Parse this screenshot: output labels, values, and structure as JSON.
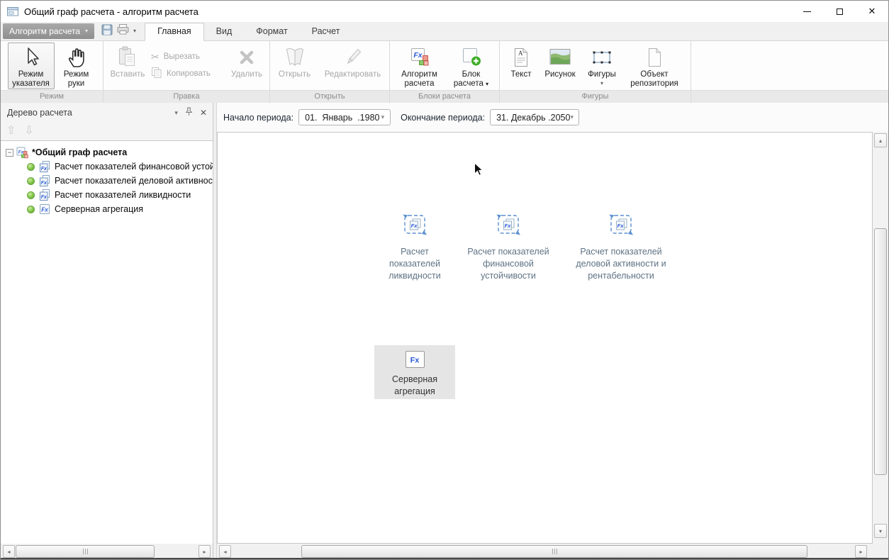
{
  "window": {
    "title": "Общий граф расчета - алгоритм расчета"
  },
  "menubar": {
    "app_button": "Алгоритм расчета",
    "tabs": [
      {
        "label": "Главная",
        "active": true
      },
      {
        "label": "Вид",
        "active": false
      },
      {
        "label": "Формат",
        "active": false
      },
      {
        "label": "Расчет",
        "active": false
      }
    ]
  },
  "ribbon": {
    "groups": [
      {
        "label": "Режим",
        "buttons": [
          {
            "label": "Режим указателя",
            "icon": "pointer-mode-icon",
            "enabled": true,
            "selected": true
          },
          {
            "label": "Режим руки",
            "icon": "hand-mode-icon",
            "enabled": true,
            "selected": false
          }
        ]
      },
      {
        "label": "Правка",
        "buttons": [
          {
            "label": "Вставить",
            "icon": "paste-icon",
            "enabled": false
          },
          {
            "label": "Вырезать",
            "icon": "cut-icon",
            "enabled": false
          },
          {
            "label": "Копировать",
            "icon": "copy-icon",
            "enabled": false
          },
          {
            "label": "Удалить",
            "icon": "delete-icon",
            "enabled": false
          }
        ]
      },
      {
        "label": "Открыть",
        "buttons": [
          {
            "label": "Открыть",
            "icon": "open-book-icon",
            "enabled": false
          },
          {
            "label": "Редактировать",
            "icon": "edit-pencil-icon",
            "enabled": false
          }
        ]
      },
      {
        "label": "Блоки расчета",
        "buttons": [
          {
            "label": "Алгоритм расчета",
            "icon": "fx-algorithm-icon",
            "enabled": true
          },
          {
            "label": "Блок расчета",
            "icon": "add-block-icon",
            "enabled": true,
            "has_dropdown": true
          }
        ]
      },
      {
        "label": "Фигуры",
        "buttons": [
          {
            "label": "Текст",
            "icon": "text-document-icon",
            "enabled": true
          },
          {
            "label": "Рисунок",
            "icon": "picture-icon",
            "enabled": true
          },
          {
            "label": "Фигуры",
            "icon": "shapes-icon",
            "enabled": true,
            "has_dropdown": true
          },
          {
            "label": "Объект репозитория",
            "icon": "repository-object-icon",
            "enabled": true
          }
        ]
      }
    ]
  },
  "tree_panel": {
    "title": "Дерево расчета",
    "root": {
      "label": "*Общий граф расчета",
      "expanded": true
    },
    "items": [
      {
        "label": "Расчет показателей финансовой устойчивости",
        "status": "green"
      },
      {
        "label": "Расчет показателей деловой активности и рентабельности",
        "status": "green"
      },
      {
        "label": "Расчет показателей ликвидности",
        "status": "green"
      },
      {
        "label": "Серверная агрегация",
        "status": "green"
      }
    ]
  },
  "period_bar": {
    "start_label": "Начало периода:",
    "start_value": "01.  Январь  .1980",
    "end_label": "Окончание периода:",
    "end_value": "31. Декабрь .2050"
  },
  "canvas": {
    "blocks": [
      {
        "lines": [
          "Расчет",
          "показателей",
          "ликвидности"
        ],
        "selected": false
      },
      {
        "lines": [
          "Расчет показателей",
          "финансовой",
          "устойчивости"
        ],
        "selected": false
      },
      {
        "lines": [
          "Расчет показателей",
          "деловой активности и",
          "рентабельности"
        ],
        "selected": false
      },
      {
        "lines": [
          "Серверная",
          "агрегация"
        ],
        "selected": true
      }
    ]
  },
  "icons": {
    "dropdown": "▾",
    "close": "✕",
    "scissors": "✂",
    "minus": "−",
    "move_up": "⇧",
    "move_down": "⇩",
    "scroll_up": "▴",
    "scroll_down": "▾",
    "scroll_left": "◂",
    "scroll_right": "▸"
  },
  "colors": {
    "fx_blue": "#2b5cd6",
    "status_green": "#79c143",
    "block_label": "#5f7384",
    "selected_block_bg": "#e5e5e5"
  }
}
